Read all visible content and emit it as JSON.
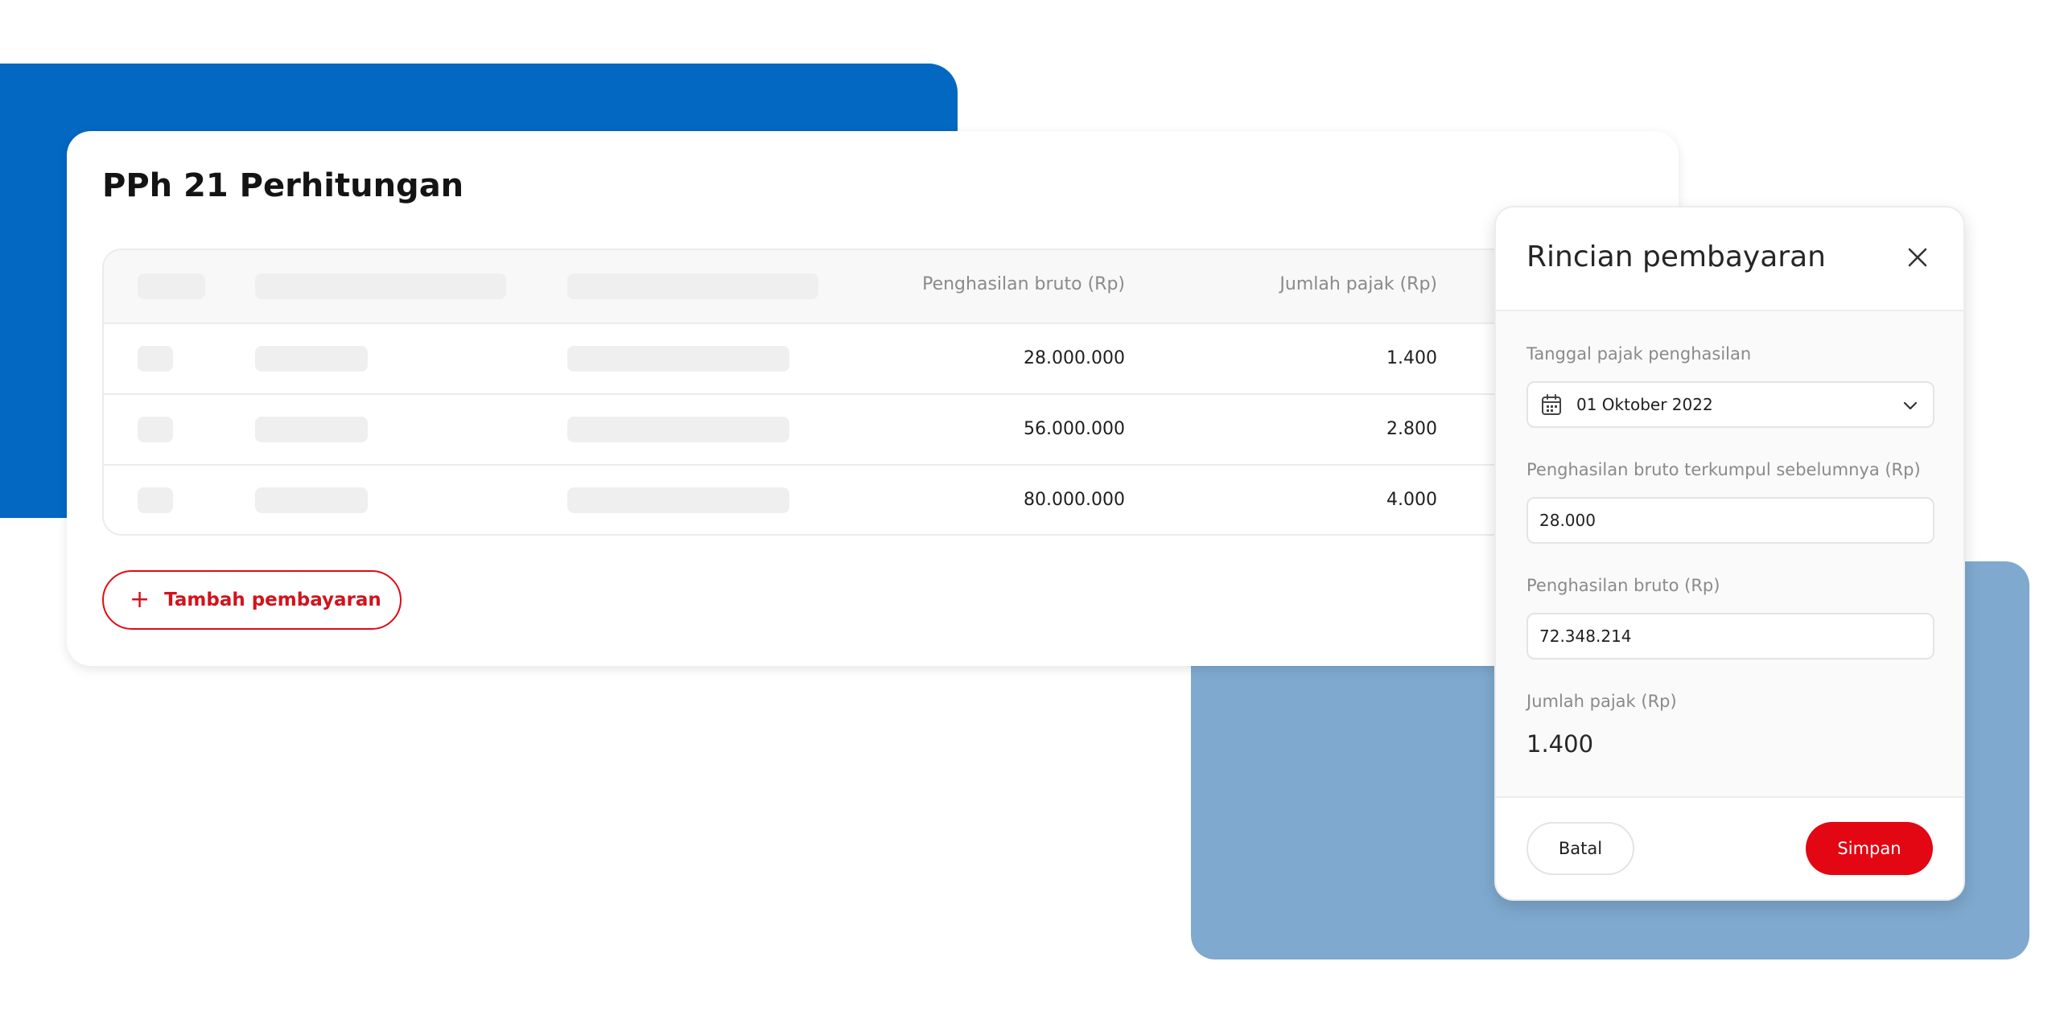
{
  "colors": {
    "background_dark_blue": "#0268c1",
    "background_light_blue": "#7fa9cf",
    "accent_red": "#e30613"
  },
  "main": {
    "title": "PPh 21 Perhitungan",
    "table": {
      "columns": [
        "Penghasilan bruto (Rp)",
        "Jumlah pajak (Rp)"
      ],
      "rows": [
        {
          "bruto": "28.000.000",
          "pajak": "1.400"
        },
        {
          "bruto": "56.000.000",
          "pajak": "2.800"
        },
        {
          "bruto": "80.000.000",
          "pajak": "4.000"
        }
      ]
    },
    "add_button": {
      "label": "Tambah pembayaran",
      "icon": "plus-icon"
    }
  },
  "panel": {
    "title": "Rincian pembayaran",
    "close_icon": "close-icon",
    "date": {
      "label": "Tanggal pajak penghasilan",
      "value": "01 Oktober 2022",
      "icon": "calendar-icon"
    },
    "previous_bruto": {
      "label": "Penghasilan bruto terkumpul sebelumnya (Rp)",
      "value": "28.000"
    },
    "bruto": {
      "label": "Penghasilan bruto (Rp)",
      "value": "72.348.214"
    },
    "tax": {
      "label": "Jumlah pajak (Rp)",
      "value": "1.400"
    },
    "cancel_label": "Batal",
    "save_label": "Simpan"
  }
}
